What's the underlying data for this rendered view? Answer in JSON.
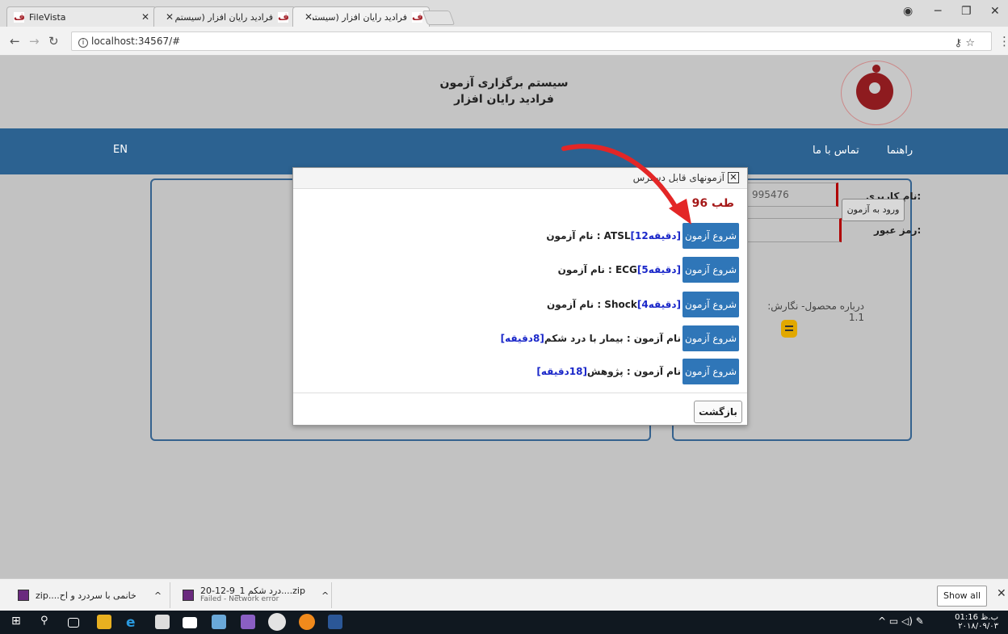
{
  "browser": {
    "tabs": [
      {
        "title": "FileVista"
      },
      {
        "title": "فرادید رایان افزار (سیستم بر"
      },
      {
        "title": "فرادید رایان افزار (سیستم بر"
      }
    ],
    "url": "localhost:34567/#"
  },
  "header": {
    "title_line1": "سیستم برگزاری آزمون",
    "title_line2": "فرادید رایان افزار"
  },
  "nav": {
    "lang": "EN",
    "guide": "راهنما",
    "contact": "تماس با ما"
  },
  "login": {
    "username_label": "نام کاربری:",
    "username_value": "995476",
    "password_label": "رمز عبور:",
    "submit_label": "ورود به آزمون",
    "about_text": "درباره محصول- نگارش: 1.1"
  },
  "modal": {
    "title": "آزمونهای قابل دسترس",
    "group_title": "طب 96",
    "start_label": "شروع آزمون",
    "back_label": "بازگشت",
    "exams": [
      {
        "label": "نام آزمون : ATSL",
        "duration": "[12دقیقه]"
      },
      {
        "label": "نام آزمون : ECG",
        "duration": "[5دقیقه]"
      },
      {
        "label": "نام آزمون : Shock",
        "duration": "[4دقیقه]"
      },
      {
        "label": "نام آزمون : بیمار با درد شکم",
        "duration": "[8دقیقه]"
      },
      {
        "label": "نام آزمون : پژوهش",
        "duration": "[18دقیقه]"
      }
    ]
  },
  "downloads": {
    "items": [
      {
        "name": "خانمی با سردرد و اح....zip"
      },
      {
        "name": "20-12-9_درد شکم 1....zip",
        "status": "Failed - Network error"
      }
    ],
    "show_all": "Show all"
  },
  "taskbar": {
    "time": "01:16 ب.ظ",
    "date": "۲۰۱۸/۰۹/۰۳"
  },
  "colors": {
    "navbar": "#2c6291",
    "start_button": "#2f76b8",
    "duration_text": "#1a27c9",
    "group_title": "#a51818",
    "arrow": "#e32626"
  }
}
